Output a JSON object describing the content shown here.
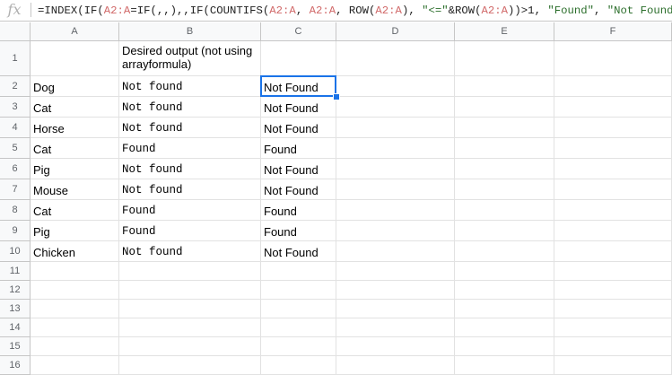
{
  "formula_bar": {
    "icon": "fx-icon",
    "segments": [
      {
        "t": "=INDEX(IF(",
        "c": ""
      },
      {
        "t": "A2:A",
        "c": "ref"
      },
      {
        "t": "=IF(,,),,IF(COUNTIFS(",
        "c": ""
      },
      {
        "t": "A2:A",
        "c": "ref"
      },
      {
        "t": ", ",
        "c": ""
      },
      {
        "t": "A2:A",
        "c": "ref"
      },
      {
        "t": ", ROW(",
        "c": ""
      },
      {
        "t": "A2:A",
        "c": "ref"
      },
      {
        "t": "), ",
        "c": ""
      },
      {
        "t": "\"<=\"",
        "c": "str"
      },
      {
        "t": "&ROW(",
        "c": ""
      },
      {
        "t": "A2:A",
        "c": "ref"
      },
      {
        "t": "))>1, ",
        "c": ""
      },
      {
        "t": "\"Found\"",
        "c": "str"
      },
      {
        "t": ", ",
        "c": ""
      },
      {
        "t": "\"Not Found\"",
        "c": "str"
      },
      {
        "t": ")))",
        "c": ""
      }
    ]
  },
  "columns": [
    "A",
    "B",
    "C",
    "D",
    "E",
    "F"
  ],
  "row_numbers": [
    "1",
    "2",
    "3",
    "4",
    "5",
    "6",
    "7",
    "8",
    "9",
    "10",
    "11",
    "12",
    "13",
    "14",
    "15",
    "16"
  ],
  "header_row": {
    "a": "",
    "b": "Desired output (not using arrayformula)",
    "c": ""
  },
  "rows": [
    {
      "a": "Dog",
      "b": "Not found",
      "c": "Not Found"
    },
    {
      "a": "Cat",
      "b": "Not found",
      "c": "Not Found"
    },
    {
      "a": "Horse",
      "b": "Not found",
      "c": "Not Found"
    },
    {
      "a": "Cat",
      "b": "Found",
      "c": "Found"
    },
    {
      "a": "Pig",
      "b": "Not found",
      "c": "Not Found"
    },
    {
      "a": "Mouse",
      "b": "Not found",
      "c": "Not Found"
    },
    {
      "a": "Cat",
      "b": "Found",
      "c": "Found"
    },
    {
      "a": "Pig",
      "b": "Found",
      "c": "Found"
    },
    {
      "a": "Chicken",
      "b": "Not found",
      "c": "Not Found"
    }
  ],
  "selected_cell": "C2",
  "colors": {
    "selection": "#1a73e8",
    "formula_ref": "#d16969",
    "formula_string": "#2b6e2b"
  }
}
